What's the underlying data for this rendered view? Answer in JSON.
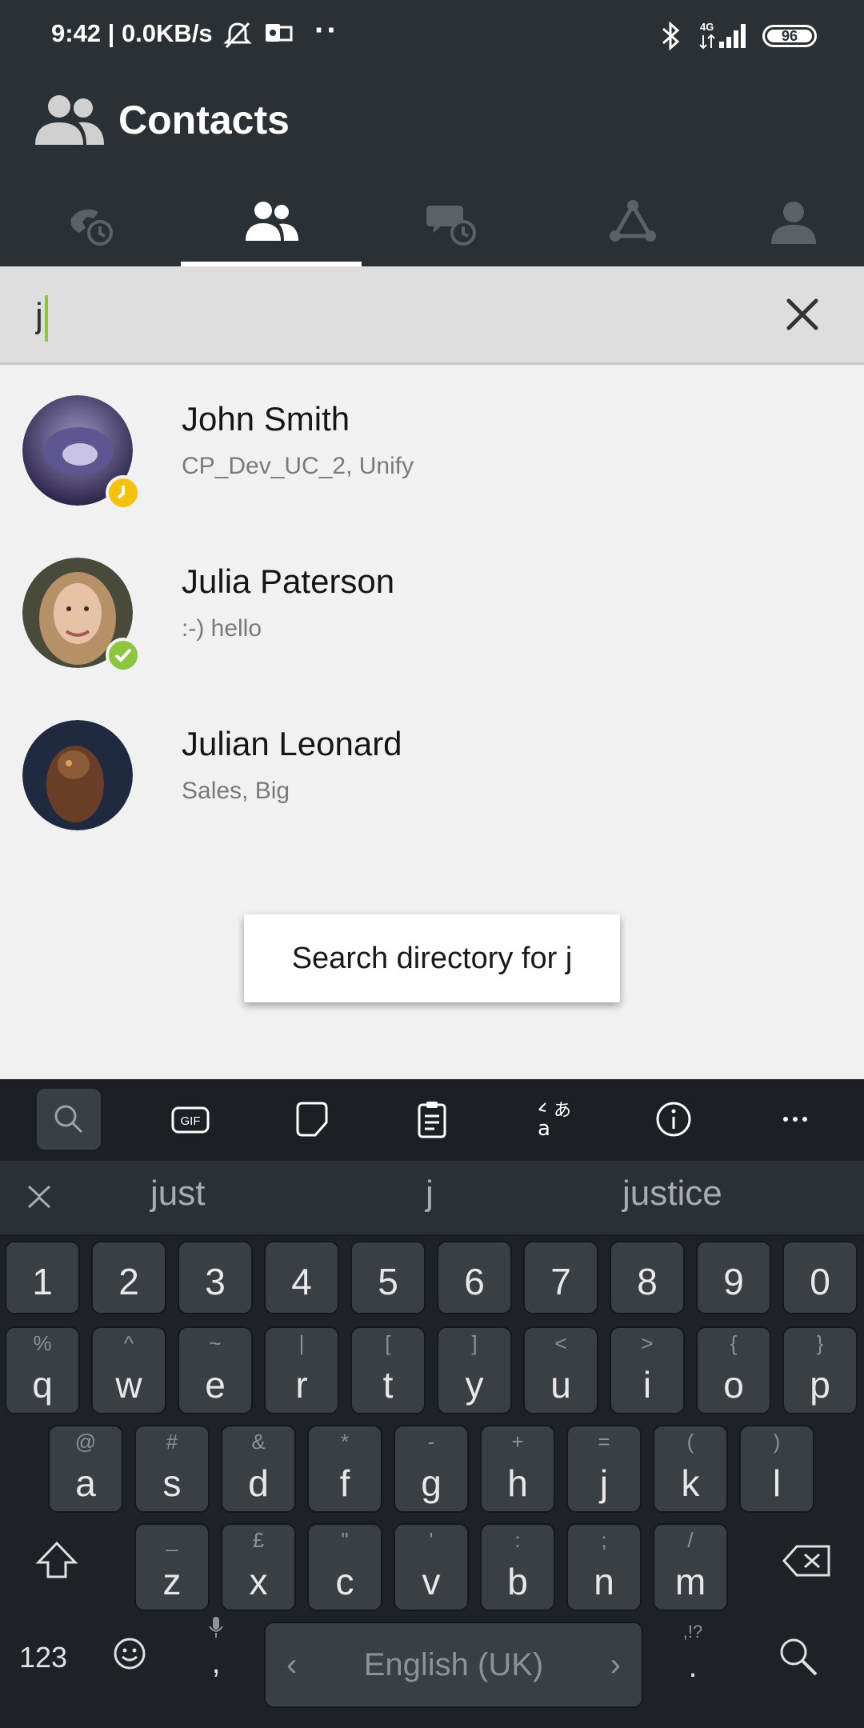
{
  "status_bar": {
    "time_and_speed": "9:42 | 0.0KB/s",
    "network": "4G",
    "battery": "96"
  },
  "app": {
    "title": "Contacts"
  },
  "tabs": [
    {
      "name": "call-history",
      "icon": "phone-history-icon",
      "active": false
    },
    {
      "name": "contacts",
      "icon": "contacts-icon",
      "active": true
    },
    {
      "name": "conversations",
      "icon": "chat-history-icon",
      "active": false
    },
    {
      "name": "network",
      "icon": "network-icon",
      "active": false
    },
    {
      "name": "profile",
      "icon": "person-icon",
      "active": false
    }
  ],
  "search": {
    "value": "j"
  },
  "contacts": [
    {
      "name": "John Smith",
      "subtitle": "CP_Dev_UC_2, Unify",
      "presence": "busy",
      "presence_color": "#f4c20d"
    },
    {
      "name": "Julia Paterson",
      "subtitle": ":-) hello",
      "presence": "available",
      "presence_color": "#8cc63f"
    },
    {
      "name": "Julian Leonard",
      "subtitle": "Sales, Big",
      "presence": "none",
      "presence_color": ""
    }
  ],
  "directory_button": "Search directory for j",
  "keyboard": {
    "suggestions": [
      "just",
      "j",
      "justice"
    ],
    "number_row": [
      "1",
      "2",
      "3",
      "4",
      "5",
      "6",
      "7",
      "8",
      "9",
      "0"
    ],
    "row1": [
      [
        "q",
        "%"
      ],
      [
        "w",
        "^"
      ],
      [
        "e",
        "~"
      ],
      [
        "r",
        "|"
      ],
      [
        "t",
        "["
      ],
      [
        "y",
        "]"
      ],
      [
        "u",
        "<"
      ],
      [
        "i",
        ">"
      ],
      [
        "o",
        "{"
      ],
      [
        "p",
        "}"
      ]
    ],
    "row2": [
      [
        "a",
        "@"
      ],
      [
        "s",
        "#"
      ],
      [
        "d",
        "&"
      ],
      [
        "f",
        "*"
      ],
      [
        "g",
        "-"
      ],
      [
        "h",
        "+"
      ],
      [
        "j",
        "="
      ],
      [
        "k",
        "("
      ],
      [
        "l",
        ")"
      ]
    ],
    "row3": [
      [
        "z",
        "_"
      ],
      [
        "x",
        "£"
      ],
      [
        "c",
        "\""
      ],
      [
        "v",
        "'"
      ],
      [
        "b",
        ":"
      ],
      [
        "n",
        ";"
      ],
      [
        "m",
        "/"
      ]
    ],
    "symbols_key": "123",
    "comma": ",",
    "space_label": "English (UK)",
    "period": ".",
    "period_alt": ",!?"
  },
  "colors": {
    "header_bg": "#2b3034",
    "accent_green": "#8cc63f",
    "presence_busy": "#f4c20d"
  }
}
